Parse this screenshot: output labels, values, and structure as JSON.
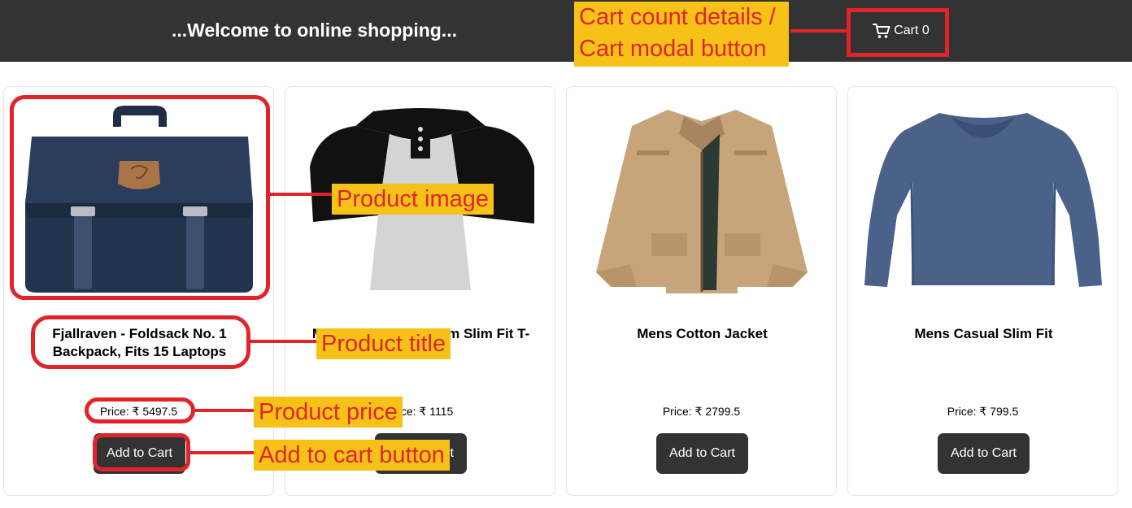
{
  "header": {
    "title": "...Welcome to online shopping...",
    "cart_label": "Cart 0",
    "cart_icon": "shopping-cart-icon",
    "background": "#333333"
  },
  "products": [
    {
      "title": "Fjallraven - Foldsack No. 1 Backpack, Fits 15 Laptops",
      "price": "Price: ₹ 5497.5",
      "button": "Add to Cart",
      "image": "backpack-image"
    },
    {
      "title": "Mens Casual Premium Slim Fit T-Shirts",
      "price": "Price: ₹ 1115",
      "button": "Add to Cart",
      "image": "raglan-tshirt-image"
    },
    {
      "title": "Mens Cotton Jacket",
      "price": "Price: ₹ 2799.5",
      "button": "Add to Cart",
      "image": "cotton-jacket-image"
    },
    {
      "title": "Mens Casual Slim Fit",
      "price": "Price: ₹ 799.5",
      "button": "Add to Cart",
      "image": "slim-fit-shirt-image"
    }
  ],
  "annotations": {
    "cart": "Cart count details /\nCart modal button",
    "image": "Product image",
    "title": "Product title",
    "price": "Product price",
    "button": "Add to cart button",
    "highlight_color": "#e0242a",
    "label_background": "#f7c218"
  }
}
